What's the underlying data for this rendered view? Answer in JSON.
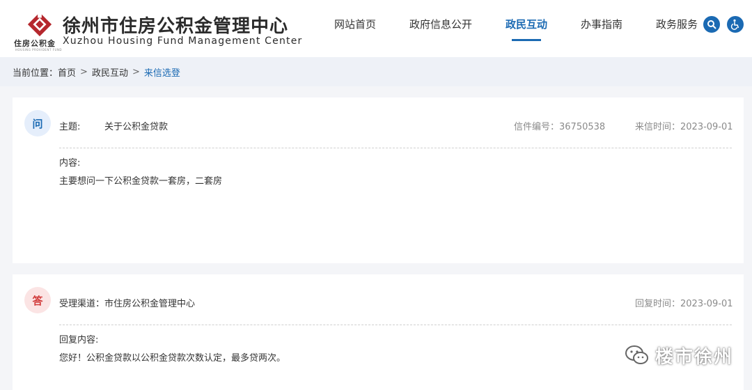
{
  "header": {
    "logo_small_cn": "住房公积金",
    "logo_small_en": "HOUSING PROVIDENT FUND",
    "title_cn": "徐州市住房公积金管理中心",
    "title_en": "Xuzhou Housing Fund Management Center",
    "brand_color": "#b5272d",
    "accent_color": "#1b6ab3"
  },
  "nav": {
    "items": [
      "网站首页",
      "政府信息公开",
      "政民互动",
      "办事指南",
      "政务服务"
    ],
    "active_index": 2,
    "search_icon": "search-icon",
    "accessibility_icon": "accessibility-icon"
  },
  "breadcrumb": {
    "label": "当前位置：",
    "items": [
      "首页",
      "政民互动",
      "来信选登"
    ],
    "separator": ">"
  },
  "question": {
    "badge": "问",
    "subject_label": "主题:",
    "subject": "关于公积金贷款",
    "letter_no": "信件编号：36750538",
    "letter_time": "来信时间：2023-09-01",
    "content_label": "内容:",
    "content": "主要想问一下公积金贷款一套房，二套房"
  },
  "answer": {
    "badge": "答",
    "channel": "受理渠道：市住房公积金管理中心",
    "reply_time": "回复时间：2023-09-01",
    "content_label": "回复内容:",
    "content": "您好！公积金贷款以公积金贷款次数认定，最多贷两次。"
  },
  "watermark": {
    "text": "楼市徐州",
    "icon": "wechat-icon"
  }
}
